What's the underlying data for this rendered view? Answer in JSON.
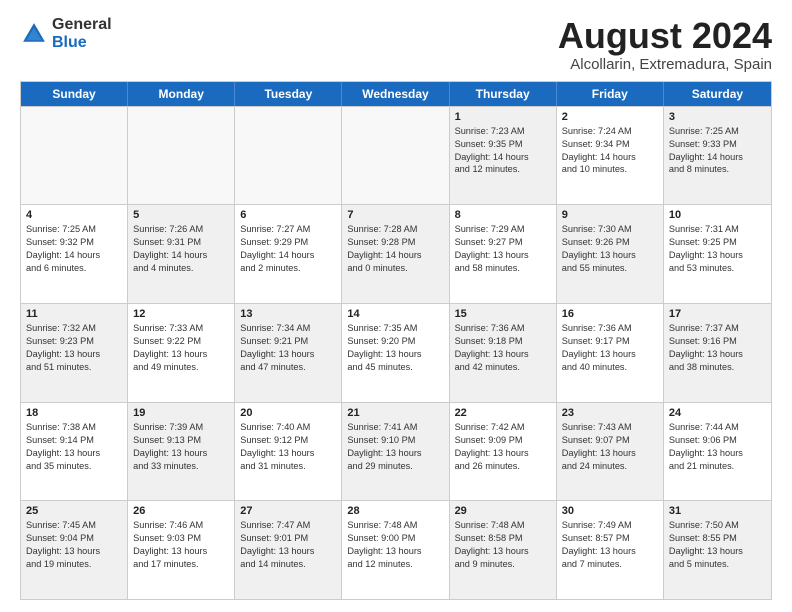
{
  "logo": {
    "general": "General",
    "blue": "Blue"
  },
  "title": "August 2024",
  "location": "Alcollarin, Extremadura, Spain",
  "header_days": [
    "Sunday",
    "Monday",
    "Tuesday",
    "Wednesday",
    "Thursday",
    "Friday",
    "Saturday"
  ],
  "rows": [
    [
      {
        "day": "",
        "lines": [],
        "empty": true
      },
      {
        "day": "",
        "lines": [],
        "empty": true
      },
      {
        "day": "",
        "lines": [],
        "empty": true
      },
      {
        "day": "",
        "lines": [],
        "empty": true
      },
      {
        "day": "1",
        "lines": [
          "Sunrise: 7:23 AM",
          "Sunset: 9:35 PM",
          "Daylight: 14 hours",
          "and 12 minutes."
        ],
        "shaded": true
      },
      {
        "day": "2",
        "lines": [
          "Sunrise: 7:24 AM",
          "Sunset: 9:34 PM",
          "Daylight: 14 hours",
          "and 10 minutes."
        ],
        "shaded": false
      },
      {
        "day": "3",
        "lines": [
          "Sunrise: 7:25 AM",
          "Sunset: 9:33 PM",
          "Daylight: 14 hours",
          "and 8 minutes."
        ],
        "shaded": true
      }
    ],
    [
      {
        "day": "4",
        "lines": [
          "Sunrise: 7:25 AM",
          "Sunset: 9:32 PM",
          "Daylight: 14 hours",
          "and 6 minutes."
        ],
        "shaded": false
      },
      {
        "day": "5",
        "lines": [
          "Sunrise: 7:26 AM",
          "Sunset: 9:31 PM",
          "Daylight: 14 hours",
          "and 4 minutes."
        ],
        "shaded": true
      },
      {
        "day": "6",
        "lines": [
          "Sunrise: 7:27 AM",
          "Sunset: 9:29 PM",
          "Daylight: 14 hours",
          "and 2 minutes."
        ],
        "shaded": false
      },
      {
        "day": "7",
        "lines": [
          "Sunrise: 7:28 AM",
          "Sunset: 9:28 PM",
          "Daylight: 14 hours",
          "and 0 minutes."
        ],
        "shaded": true
      },
      {
        "day": "8",
        "lines": [
          "Sunrise: 7:29 AM",
          "Sunset: 9:27 PM",
          "Daylight: 13 hours",
          "and 58 minutes."
        ],
        "shaded": false
      },
      {
        "day": "9",
        "lines": [
          "Sunrise: 7:30 AM",
          "Sunset: 9:26 PM",
          "Daylight: 13 hours",
          "and 55 minutes."
        ],
        "shaded": true
      },
      {
        "day": "10",
        "lines": [
          "Sunrise: 7:31 AM",
          "Sunset: 9:25 PM",
          "Daylight: 13 hours",
          "and 53 minutes."
        ],
        "shaded": false
      }
    ],
    [
      {
        "day": "11",
        "lines": [
          "Sunrise: 7:32 AM",
          "Sunset: 9:23 PM",
          "Daylight: 13 hours",
          "and 51 minutes."
        ],
        "shaded": true
      },
      {
        "day": "12",
        "lines": [
          "Sunrise: 7:33 AM",
          "Sunset: 9:22 PM",
          "Daylight: 13 hours",
          "and 49 minutes."
        ],
        "shaded": false
      },
      {
        "day": "13",
        "lines": [
          "Sunrise: 7:34 AM",
          "Sunset: 9:21 PM",
          "Daylight: 13 hours",
          "and 47 minutes."
        ],
        "shaded": true
      },
      {
        "day": "14",
        "lines": [
          "Sunrise: 7:35 AM",
          "Sunset: 9:20 PM",
          "Daylight: 13 hours",
          "and 45 minutes."
        ],
        "shaded": false
      },
      {
        "day": "15",
        "lines": [
          "Sunrise: 7:36 AM",
          "Sunset: 9:18 PM",
          "Daylight: 13 hours",
          "and 42 minutes."
        ],
        "shaded": true
      },
      {
        "day": "16",
        "lines": [
          "Sunrise: 7:36 AM",
          "Sunset: 9:17 PM",
          "Daylight: 13 hours",
          "and 40 minutes."
        ],
        "shaded": false
      },
      {
        "day": "17",
        "lines": [
          "Sunrise: 7:37 AM",
          "Sunset: 9:16 PM",
          "Daylight: 13 hours",
          "and 38 minutes."
        ],
        "shaded": true
      }
    ],
    [
      {
        "day": "18",
        "lines": [
          "Sunrise: 7:38 AM",
          "Sunset: 9:14 PM",
          "Daylight: 13 hours",
          "and 35 minutes."
        ],
        "shaded": false
      },
      {
        "day": "19",
        "lines": [
          "Sunrise: 7:39 AM",
          "Sunset: 9:13 PM",
          "Daylight: 13 hours",
          "and 33 minutes."
        ],
        "shaded": true
      },
      {
        "day": "20",
        "lines": [
          "Sunrise: 7:40 AM",
          "Sunset: 9:12 PM",
          "Daylight: 13 hours",
          "and 31 minutes."
        ],
        "shaded": false
      },
      {
        "day": "21",
        "lines": [
          "Sunrise: 7:41 AM",
          "Sunset: 9:10 PM",
          "Daylight: 13 hours",
          "and 29 minutes."
        ],
        "shaded": true
      },
      {
        "day": "22",
        "lines": [
          "Sunrise: 7:42 AM",
          "Sunset: 9:09 PM",
          "Daylight: 13 hours",
          "and 26 minutes."
        ],
        "shaded": false
      },
      {
        "day": "23",
        "lines": [
          "Sunrise: 7:43 AM",
          "Sunset: 9:07 PM",
          "Daylight: 13 hours",
          "and 24 minutes."
        ],
        "shaded": true
      },
      {
        "day": "24",
        "lines": [
          "Sunrise: 7:44 AM",
          "Sunset: 9:06 PM",
          "Daylight: 13 hours",
          "and 21 minutes."
        ],
        "shaded": false
      }
    ],
    [
      {
        "day": "25",
        "lines": [
          "Sunrise: 7:45 AM",
          "Sunset: 9:04 PM",
          "Daylight: 13 hours",
          "and 19 minutes."
        ],
        "shaded": true
      },
      {
        "day": "26",
        "lines": [
          "Sunrise: 7:46 AM",
          "Sunset: 9:03 PM",
          "Daylight: 13 hours",
          "and 17 minutes."
        ],
        "shaded": false
      },
      {
        "day": "27",
        "lines": [
          "Sunrise: 7:47 AM",
          "Sunset: 9:01 PM",
          "Daylight: 13 hours",
          "and 14 minutes."
        ],
        "shaded": true
      },
      {
        "day": "28",
        "lines": [
          "Sunrise: 7:48 AM",
          "Sunset: 9:00 PM",
          "Daylight: 13 hours",
          "and 12 minutes."
        ],
        "shaded": false
      },
      {
        "day": "29",
        "lines": [
          "Sunrise: 7:48 AM",
          "Sunset: 8:58 PM",
          "Daylight: 13 hours",
          "and 9 minutes."
        ],
        "shaded": true
      },
      {
        "day": "30",
        "lines": [
          "Sunrise: 7:49 AM",
          "Sunset: 8:57 PM",
          "Daylight: 13 hours",
          "and 7 minutes."
        ],
        "shaded": false
      },
      {
        "day": "31",
        "lines": [
          "Sunrise: 7:50 AM",
          "Sunset: 8:55 PM",
          "Daylight: 13 hours",
          "and 5 minutes."
        ],
        "shaded": true
      }
    ]
  ]
}
